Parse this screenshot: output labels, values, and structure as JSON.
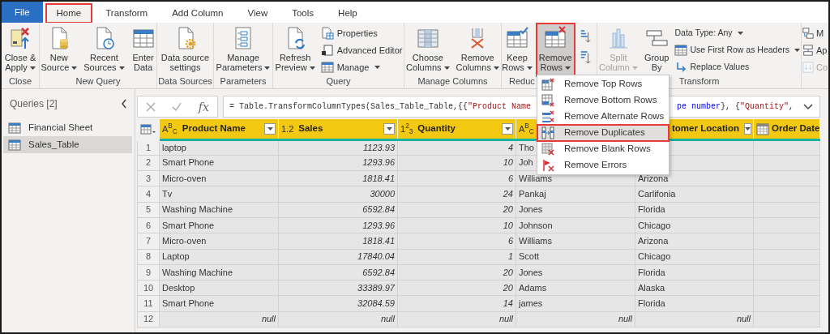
{
  "tabs": [
    {
      "label": "File",
      "kind": "backstage",
      "selected": false,
      "annotated": false
    },
    {
      "label": "Home",
      "kind": "tab",
      "selected": true,
      "annotated": true
    },
    {
      "label": "Transform",
      "kind": "tab",
      "selected": false,
      "annotated": false
    },
    {
      "label": "Add Column",
      "kind": "tab",
      "selected": false,
      "annotated": false
    },
    {
      "label": "View",
      "kind": "tab",
      "selected": false,
      "annotated": false
    },
    {
      "label": "Tools",
      "kind": "tab",
      "selected": false,
      "annotated": false
    },
    {
      "label": "Help",
      "kind": "tab",
      "selected": false,
      "annotated": false
    }
  ],
  "ribbon": {
    "groups": [
      {
        "label": "Close",
        "items": [
          {
            "kind": "large",
            "lines": [
              "Close &",
              "Apply"
            ],
            "dropdown": true,
            "disabled": false,
            "pressed": false,
            "annotated": false
          }
        ]
      },
      {
        "label": "New Query",
        "items": [
          {
            "kind": "large",
            "lines": [
              "New",
              "Source"
            ],
            "dropdown": true,
            "disabled": false,
            "pressed": false,
            "annotated": false
          },
          {
            "kind": "large",
            "lines": [
              "Recent",
              "Sources"
            ],
            "dropdown": true,
            "disabled": false,
            "pressed": false,
            "annotated": false
          },
          {
            "kind": "large",
            "lines": [
              "Enter",
              "Data"
            ],
            "dropdown": false,
            "disabled": false,
            "pressed": false,
            "annotated": false
          }
        ]
      },
      {
        "label": "Data Sources",
        "items": [
          {
            "kind": "large",
            "lines": [
              "Data source",
              "settings"
            ],
            "dropdown": false,
            "disabled": false,
            "pressed": false,
            "annotated": false
          }
        ]
      },
      {
        "label": "Parameters",
        "items": [
          {
            "kind": "large",
            "lines": [
              "Manage",
              "Parameters"
            ],
            "dropdown": true,
            "disabled": false,
            "pressed": false,
            "annotated": false
          }
        ]
      },
      {
        "label": "Query",
        "items": [
          {
            "kind": "large",
            "lines": [
              "Refresh",
              "Preview"
            ],
            "dropdown": true,
            "disabled": false,
            "pressed": false,
            "annotated": false
          },
          {
            "kind": "stack",
            "items": [
              {
                "label": "Properties",
                "dropdown": false,
                "disabled": false
              },
              {
                "label": "Advanced Editor",
                "dropdown": false,
                "disabled": false
              },
              {
                "label": "Manage",
                "dropdown": true,
                "disabled": false
              }
            ]
          }
        ]
      },
      {
        "label": "Manage Columns",
        "items": [
          {
            "kind": "large",
            "lines": [
              "Choose",
              "Columns"
            ],
            "dropdown": true,
            "disabled": false,
            "pressed": false,
            "annotated": false
          },
          {
            "kind": "large",
            "lines": [
              "Remove",
              "Columns"
            ],
            "dropdown": true,
            "disabled": false,
            "pressed": false,
            "annotated": false
          }
        ]
      },
      {
        "label": "Reduc",
        "items": [
          {
            "kind": "large",
            "lines": [
              "Keep",
              "Rows"
            ],
            "dropdown": true,
            "disabled": false,
            "pressed": false,
            "annotated": false
          },
          {
            "kind": "large",
            "lines": [
              "Remove",
              "Rows"
            ],
            "dropdown": true,
            "disabled": false,
            "pressed": true,
            "annotated": true
          }
        ]
      },
      {
        "items": [
          {
            "kind": "sort"
          }
        ]
      },
      {
        "label": "Transform",
        "items": [
          {
            "kind": "large",
            "lines": [
              "Split",
              "Column"
            ],
            "dropdown": true,
            "disabled": true,
            "pressed": false,
            "annotated": false
          },
          {
            "kind": "large",
            "lines": [
              "Group",
              "By"
            ],
            "dropdown": false,
            "disabled": false,
            "pressed": false,
            "annotated": false
          },
          {
            "kind": "stack",
            "items": [
              {
                "label": "Data Type: Any",
                "dropdown": true,
                "disabled": false
              },
              {
                "label": "Use First Row as Headers",
                "dropdown": true,
                "disabled": false
              },
              {
                "label": "Replace Values",
                "dropdown": false,
                "disabled": false
              }
            ]
          }
        ]
      },
      {
        "items": [
          {
            "kind": "stack",
            "items": [
              {
                "label": "M",
                "dropdown": false,
                "disabled": false
              },
              {
                "label": "Ap",
                "dropdown": false,
                "disabled": false
              },
              {
                "label": "Co",
                "dropdown": false,
                "disabled": true
              }
            ]
          }
        ]
      }
    ]
  },
  "queries": {
    "title": "Queries [2]",
    "items": [
      {
        "label": "Financial Sheet",
        "selected": false
      },
      {
        "label": "Sales_Table",
        "selected": true
      }
    ]
  },
  "formula_bar": {
    "function_label": "fx",
    "visible_start": [
      {
        "kind": "plain",
        "text": "= Table.TransformColumnTypes(Sales_Table_Table,{{"
      },
      {
        "kind": "string",
        "text": "\"Product Name"
      }
    ],
    "visible_end": [
      {
        "kind": "keyword",
        "text": "pe number"
      },
      {
        "kind": "plain",
        "text": "}, {"
      },
      {
        "kind": "string",
        "text": "\"Quantity\""
      },
      {
        "kind": "plain",
        "text": ","
      }
    ]
  },
  "table": {
    "columns": [
      {
        "kind": "text",
        "type_label": "A$^{B}$$_{C}$",
        "name": "Product Name",
        "filter_button": true
      },
      {
        "kind": "number",
        "type_label": "1.2",
        "name": "Sales",
        "filter_button": true
      },
      {
        "kind": "number",
        "type_label": "1$^{2}$$_{3}$",
        "name": "Quantity",
        "filter_button": true
      },
      {
        "kind": "text",
        "type_label": "A$^{B}$$_{C}$"
      },
      {
        "kind": "text",
        "name": "tomer Location",
        "filter_button": true
      },
      {
        "kind": "date",
        "name": "Order Date"
      }
    ],
    "rows": [
      {
        "number": "1",
        "empty": false,
        "cells": [
          "laptop",
          "1123.93",
          "4",
          "Tho"
        ]
      },
      {
        "number": "2",
        "empty": false,
        "cells": [
          "Smart Phone",
          "1293.96",
          "10",
          "Joh"
        ]
      },
      {
        "number": "3",
        "empty": false,
        "cells": [
          "Micro-oven",
          "1818.41",
          "6",
          "Williams",
          "Arizona"
        ]
      },
      {
        "number": "4",
        "empty": false,
        "cells": [
          "Tv",
          "30000",
          "24",
          "Pankaj",
          "Carlifonia"
        ]
      },
      {
        "number": "5",
        "empty": false,
        "cells": [
          "Washing Machine",
          "6592.84",
          "20",
          "Jones",
          "Florida"
        ]
      },
      {
        "number": "6",
        "empty": false,
        "cells": [
          "Smart Phone",
          "1293.96",
          "10",
          "Johnson",
          "Chicago"
        ]
      },
      {
        "number": "7",
        "empty": false,
        "cells": [
          "Micro-oven",
          "1818.41",
          "6",
          "Williams",
          "Arizona"
        ]
      },
      {
        "number": "8",
        "empty": false,
        "cells": [
          "Laptop",
          "17840.04",
          "1",
          "Scott",
          "Chicago"
        ]
      },
      {
        "number": "9",
        "empty": false,
        "cells": [
          "Washing Machine",
          "6592.84",
          "20",
          "Jones",
          "Florida"
        ]
      },
      {
        "number": "10",
        "empty": false,
        "cells": [
          "Desktop",
          "33389.97",
          "20",
          "Adams",
          "Alaska"
        ]
      },
      {
        "number": "11",
        "empty": false,
        "cells": [
          "Smart Phone",
          "32084.59",
          "14",
          "james",
          "Florida"
        ]
      },
      {
        "number": "12",
        "empty": true,
        "cells": [
          "null",
          "null",
          "null",
          "null",
          "null"
        ]
      }
    ]
  },
  "remove_rows_menu": {
    "items": [
      {
        "label": "Remove Top Rows",
        "highlighted": false,
        "annotated": false
      },
      {
        "label": "Remove Bottom Rows",
        "highlighted": false,
        "annotated": false
      },
      {
        "label": "Remove Alternate Rows",
        "highlighted": false,
        "annotated": false
      },
      {
        "label": "Remove Duplicates",
        "highlighted": true,
        "annotated": true
      },
      {
        "label": "Remove Blank Rows",
        "highlighted": false,
        "annotated": false
      },
      {
        "label": "Remove Errors",
        "highlighted": false,
        "annotated": false
      }
    ]
  }
}
